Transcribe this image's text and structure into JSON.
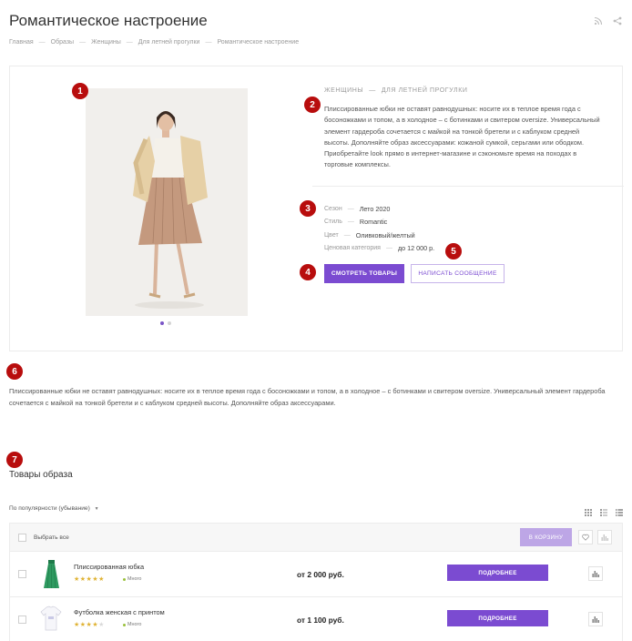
{
  "page": {
    "title": "Романтическое настроение"
  },
  "breadcrumb": [
    "Главная",
    "Образы",
    "Женщины",
    "Для летней прогулки",
    "Романтическое настроение"
  ],
  "markers": [
    "1",
    "2",
    "3",
    "4",
    "5",
    "6",
    "7"
  ],
  "look": {
    "section_path": [
      "Женщины",
      "Для летней прогулки"
    ],
    "description": "Плиссированные юбки не оставят равнодушных: носите их в теплое время года с босоножками и топом, а в холодное – с ботинками и свитером oversize. Универсальный элемент гардероба сочетается с майкой на тонкой бретели и с каблуком средней высоты. Дополняйте образ аксессуарами: кожаной сумкой, серьгами или ободком. Приобретайте look прямо в интернет-магазине и сэкономьте время на походах в торговые комплексы.",
    "properties": [
      {
        "label": "Сезон",
        "value": "Лето 2020"
      },
      {
        "label": "Стиль",
        "value": "Romantic"
      },
      {
        "label": "Цвет",
        "value": "Оливковый/желтый"
      },
      {
        "label": "Ценовая категория",
        "value": "до 12 000 р."
      }
    ],
    "primary_button": "Смотреть товары",
    "secondary_button": "Написать сообщение"
  },
  "long_description": "Плиссированные юбки не оставят равнодушных: носите их в теплое время года с босоножками и топом, а в холодное – с ботинками и свитером oversize. Универсальный элемент гардероба сочетается с майкой на тонкой бретели и с каблуком средней высоты. Дополняйте образ аксессуарами.",
  "products": {
    "title": "Товары образа",
    "sort_label": "По популярности (убывание)",
    "select_all": "Выбрать все",
    "cart_button": "В корзину",
    "items": [
      {
        "name": "Плиссированная юбка",
        "rating": 5,
        "stock": "Много",
        "price": "от 2 000 руб.",
        "button": "Подробнее"
      },
      {
        "name": "Футболка женская с принтом",
        "rating": 4,
        "stock": "Много",
        "price": "от 1 100 руб.",
        "button": "Подробнее"
      }
    ]
  },
  "colors": {
    "accent": "#7b4bd1",
    "accent_disabled": "#bda6e6",
    "marker": "#b80d0d",
    "star": "#e0b334",
    "stock": "#9ac13b"
  },
  "icons": {
    "top": [
      "rss-icon",
      "share-icon"
    ],
    "views": [
      "tile-view-icon",
      "list-view-icon",
      "table-view-icon"
    ],
    "row_actions": [
      "compare-icon"
    ],
    "head_actions": [
      "favorite-icon",
      "compare-icon"
    ]
  }
}
